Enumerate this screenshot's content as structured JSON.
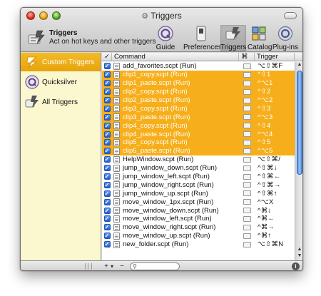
{
  "window": {
    "title": "Triggers"
  },
  "header": {
    "title": "Triggers",
    "subtitle": "Act on hot keys and other triggers"
  },
  "toolbar": [
    {
      "label": "Guide",
      "icon": "quicksilver-icon"
    },
    {
      "label": "Preferences",
      "icon": "preferences-switch-icon"
    },
    {
      "label": "Triggers",
      "icon": "triggers-icon",
      "selected": true
    },
    {
      "label": "Catalog",
      "icon": "catalog-icon"
    },
    {
      "label": "Plug-ins",
      "icon": "plugins-icon"
    }
  ],
  "sidebar": [
    {
      "label": "Custom Triggers",
      "icon": "custom-triggers-icon",
      "selected": true
    },
    {
      "label": "Quicksilver",
      "icon": "quicksilver-icon"
    },
    {
      "label": "All Triggers",
      "icon": "all-triggers-icon"
    }
  ],
  "table": {
    "headers": {
      "check": "✓",
      "command": "Command",
      "type": "⌘",
      "trigger": "Trigger"
    },
    "rows": [
      {
        "command": "add_favorites.scpt (Run)",
        "trigger": "⌥⇧⌘F",
        "hl": false
      },
      {
        "command": "clip1_copy.scpt (Run)",
        "trigger": "^⇧1",
        "hl": true
      },
      {
        "command": "clip1_paste.scpt (Run)",
        "trigger": "^⌥1",
        "hl": true
      },
      {
        "command": "clip2_copy.scpt (Run)",
        "trigger": "^⇧2",
        "hl": true
      },
      {
        "command": "clip2_paste.scpt (Run)",
        "trigger": "^⌥2",
        "hl": true
      },
      {
        "command": "clip3_copy.scpt (Run)",
        "trigger": "^⇧3",
        "hl": true
      },
      {
        "command": "clip3_paste.scpt (Run)",
        "trigger": "^⌥3",
        "hl": true
      },
      {
        "command": "clip4_copy.scpt (Run)",
        "trigger": "^⇧4",
        "hl": true
      },
      {
        "command": "clip4_paste.scpt (Run)",
        "trigger": "^⌥4",
        "hl": true
      },
      {
        "command": "clip5_copy.scpt (Run)",
        "trigger": "^⇧5",
        "hl": true
      },
      {
        "command": "clip5_paste.scpt (Run)",
        "trigger": "^⌥5",
        "hl": true
      },
      {
        "command": "HelpWindow.scpt (Run)",
        "trigger": "⌥⇧⌘/",
        "hl": false
      },
      {
        "command": "jump_window_down.scpt (Run)",
        "trigger": "^⇧⌘↓",
        "hl": false
      },
      {
        "command": "jump_window_left.scpt (Run)",
        "trigger": "^⇧⌘←",
        "hl": false
      },
      {
        "command": "jump_window_right.scpt (Run)",
        "trigger": "^⇧⌘→",
        "hl": false
      },
      {
        "command": "jump_window_up.scpt (Run)",
        "trigger": "^⇧⌘↑",
        "hl": false
      },
      {
        "command": "move_window_1px.scpt (Run)",
        "trigger": "^⌥X",
        "hl": false
      },
      {
        "command": "move_window_down.scpt (Run)",
        "trigger": "^⌘↓",
        "hl": false
      },
      {
        "command": "move_window_left.scpt (Run)",
        "trigger": "^⌘←",
        "hl": false
      },
      {
        "command": "move_window_right.scpt (Run)",
        "trigger": "^⌘→",
        "hl": false
      },
      {
        "command": "move_window_up.scpt (Run)",
        "trigger": "^⌘↑",
        "hl": false
      },
      {
        "command": "new_folder.scpt (Run)",
        "trigger": "⌥⇧⌘N",
        "hl": false
      }
    ]
  },
  "bottombar": {
    "add": "+",
    "add_menu": "▾",
    "remove": "−",
    "info": "i"
  },
  "colors": {
    "highlight": "#f6ae1b",
    "sidebar_bg": "#fbf7ce",
    "selection_blue": "#1d5fd1"
  }
}
